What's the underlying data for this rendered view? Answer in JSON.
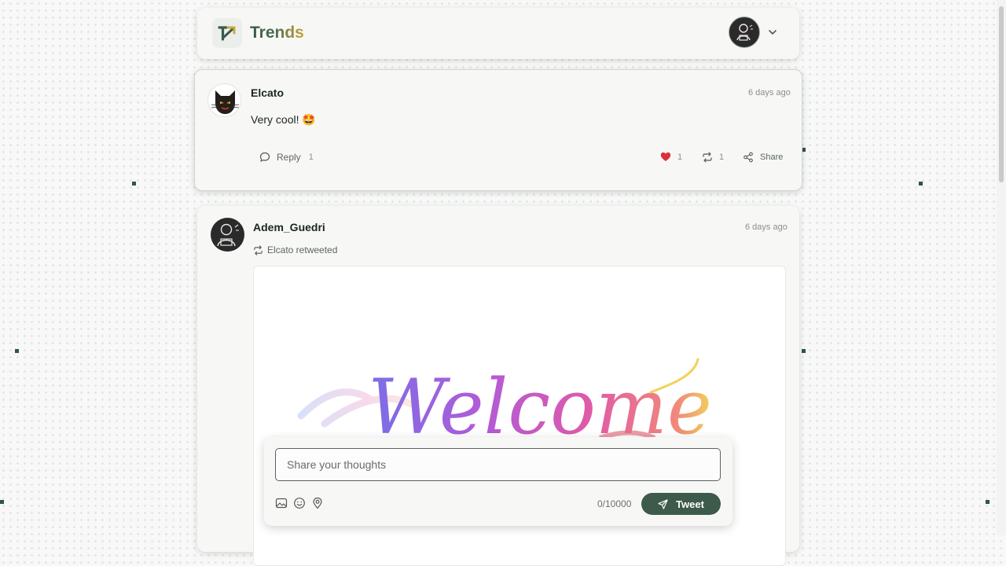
{
  "header": {
    "brand": "Trends",
    "logo_icon": "trend-arrow-icon",
    "avatar_icon": "user-avatar-icon",
    "menu_icon": "chevron-down-icon"
  },
  "reply": {
    "username": "Elcato",
    "time": "6 days ago",
    "text": "Very cool! 🤩",
    "reply_label": "Reply",
    "reply_count": "1",
    "like_count": "1",
    "retweet_count": "1",
    "share_label": "Share"
  },
  "post": {
    "username": "Adem_Guedri",
    "time": "6 days ago",
    "retweet_note": "Elcato retweeted",
    "image_text": "Welcome"
  },
  "composer": {
    "placeholder": "Share your thoughts",
    "char_count": "0/10000",
    "tweet_label": "Tweet"
  },
  "colors": {
    "accent": "#3d5a4a",
    "like": "#d9323a",
    "card_bg": "#f7f8f5"
  }
}
